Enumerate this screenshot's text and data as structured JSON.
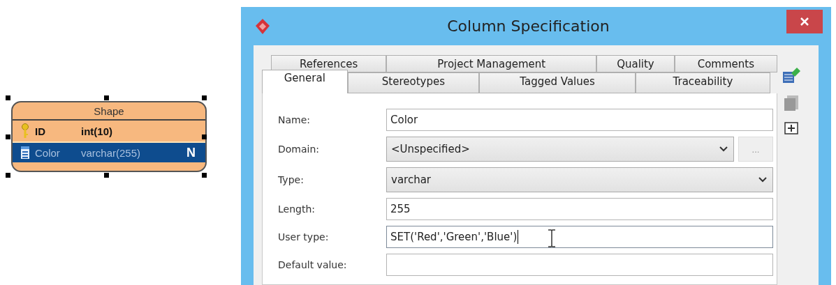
{
  "entity": {
    "name": "Shape",
    "selected": true,
    "columns": [
      {
        "kind": "primary-key",
        "name": "ID",
        "type": "int(10)",
        "selected": false
      },
      {
        "kind": "column",
        "name": "Color",
        "type": "varchar(255)",
        "selected": true,
        "badge": "N"
      }
    ]
  },
  "dialog": {
    "title": "Column Specification",
    "tab_rows": [
      [
        {
          "label": "References",
          "selected": false
        },
        {
          "label": "Project Management",
          "selected": false
        },
        {
          "label": "Quality",
          "selected": false
        },
        {
          "label": "Comments",
          "selected": false
        }
      ],
      [
        {
          "label": "General",
          "selected": true
        },
        {
          "label": "Stereotypes",
          "selected": false
        },
        {
          "label": "Tagged Values",
          "selected": false
        },
        {
          "label": "Traceability",
          "selected": false
        }
      ]
    ],
    "fields": [
      {
        "label": "Name:",
        "kind": "text",
        "value": "Color",
        "focused": false
      },
      {
        "label": "Domain:",
        "kind": "select",
        "value": "<Unspecified>",
        "button": "..."
      },
      {
        "label": "Type:",
        "kind": "select",
        "value": "varchar"
      },
      {
        "label": "Length:",
        "kind": "text",
        "value": "255",
        "focused": false
      },
      {
        "label": "User type:",
        "kind": "text",
        "value": "SET('Red','Green','Blue')",
        "focused": true
      },
      {
        "label": "Default value:",
        "kind": "text",
        "focused": false
      }
    ]
  }
}
